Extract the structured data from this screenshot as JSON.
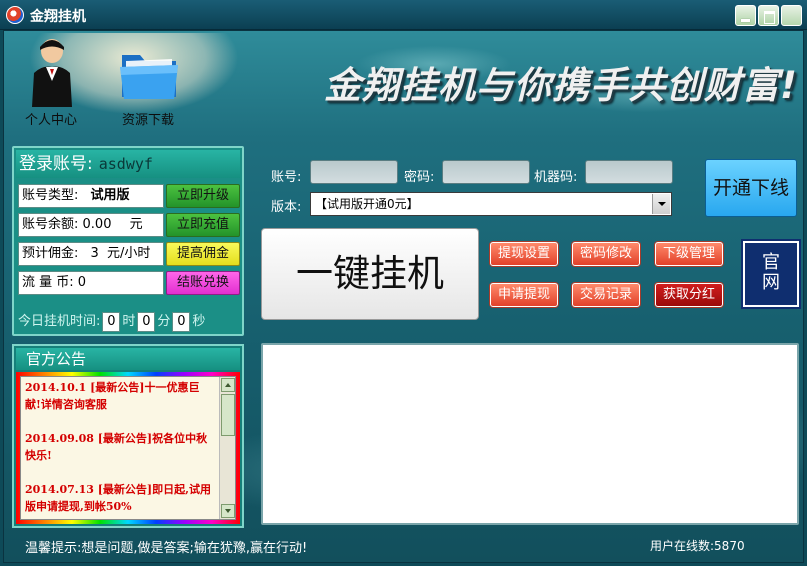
{
  "window": {
    "title": "金翔挂机"
  },
  "banner": {
    "slogan": "金翔挂机与你携手共创财富!"
  },
  "topnav": {
    "user_center": "个人中心",
    "download": "资源下载"
  },
  "account": {
    "login_label": "登录账号:",
    "username": "asdwyf",
    "type_label": "账号类型:",
    "type_value": "试用版",
    "balance_label": "账号余额:",
    "balance_value": "0.00",
    "balance_unit": "元",
    "commission_label": "预计佣金:",
    "commission_value": "3",
    "commission_unit": "元/小时",
    "coins_label": "流 量 币:",
    "coins_value": "0",
    "upgrade_button": "立即升级",
    "recharge_button": "立即充值",
    "raise_commission_button": "提高佣金",
    "exchange_button": "结账兑换",
    "online_time_label": "今日挂机时间:",
    "hours": "0",
    "hours_unit": "时",
    "minutes": "0",
    "minutes_unit": "分",
    "seconds": "0",
    "seconds_unit": "秒"
  },
  "notice": {
    "title": "官方公告",
    "items": [
      "2014.10.1 [最新公告]十一优惠巨献!详情咨询客服",
      "2014.09.08 [最新公告]祝各位中秋快乐!",
      "2014.07.13 [最新公告]即日起,试用版申请提现,到帐50%"
    ]
  },
  "form": {
    "account_label": "账号:",
    "account_value": "",
    "password_label": "密码:",
    "password_value": "",
    "machine_label": "机器码:",
    "machine_value": "",
    "version_label": "版本:",
    "version_value": "【试用版开通0元】"
  },
  "actions": {
    "open_download": "开通下线",
    "one_click": "一键挂机",
    "withdraw_settings": "提现设置",
    "change_password": "密码修改",
    "downline_management": "下级管理",
    "apply_withdraw": "申请提现",
    "transaction_records": "交易记录",
    "get_dividend": "获取分红",
    "official_site_line1": "官",
    "official_site_line2": "网"
  },
  "footer": {
    "tip": "温馨提示:想是问题,做是答案;输在犹豫,赢在行动!",
    "online_users_label": "用户在线数:",
    "online_users_value": "5870"
  }
}
